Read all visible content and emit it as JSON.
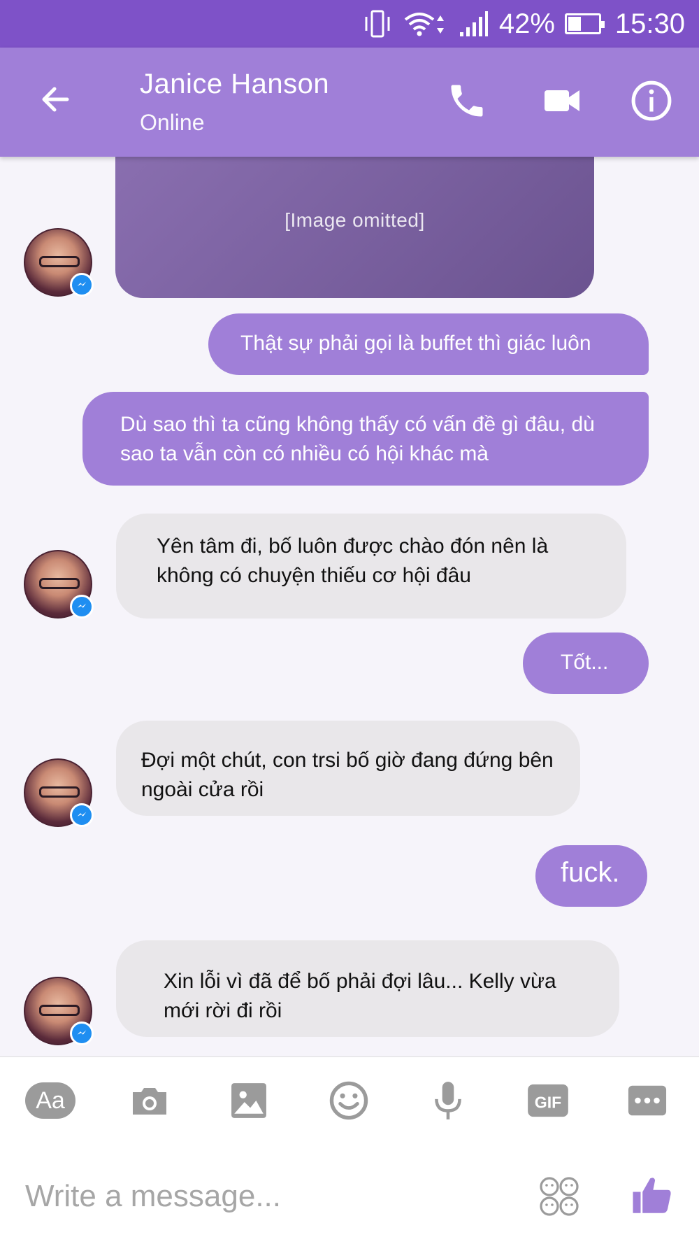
{
  "status_bar": {
    "battery_percent": "42%",
    "battery_level": 0.42,
    "time": "15:30",
    "icons": [
      "vibrate-icon",
      "wifi-icon",
      "signal-icon",
      "battery-icon"
    ]
  },
  "header": {
    "contact_name": "Janice Hanson",
    "contact_status": "Online",
    "icons": [
      "back-arrow-icon",
      "phone-icon",
      "video-camera-icon",
      "info-icon"
    ]
  },
  "thread": {
    "image_message": {
      "from": "contact",
      "placeholder_text": "[Image omitted]"
    },
    "messages": [
      {
        "from": "me",
        "text": "Thật sự phải gọi là buffet thì giác luôn"
      },
      {
        "from": "me",
        "text": "Dù sao thì ta cũng không thấy có vấn đề gì đâu, dù sao ta vẫn còn có nhiều có hội khác mà"
      },
      {
        "from": "contact",
        "text": "Yên tâm đi, bố luôn được chào đón nên là không có chuyện thiếu cơ hội đâu"
      },
      {
        "from": "me",
        "text": "Tốt..."
      },
      {
        "from": "contact",
        "text": "Đợi một chút, con trsi bố giờ đang đứng bên ngoài cửa rồi"
      },
      {
        "from": "me",
        "text": "fuck."
      },
      {
        "from": "contact",
        "text": "Xin lỗi vì đã để bố phải đợi lâu... Kelly vừa mới rời đi rồi"
      }
    ]
  },
  "composer": {
    "aa_label": "Aa",
    "placeholder": "Write a message...",
    "gif_label": "GIF",
    "icons": [
      "text-style-icon",
      "camera-icon",
      "gallery-icon",
      "emoji-icon",
      "microphone-icon",
      "gif-icon",
      "more-icon",
      "sticker-grid-icon",
      "thumbs-up-icon"
    ]
  },
  "colors": {
    "status_bar": "#7e52c8",
    "header": "#a07fd8",
    "outgoing_bubble": "#a07fd8",
    "incoming_bubble": "#e9e7ea",
    "icon_gray": "#9b9b9b",
    "messenger_badge": "#1f8ef1"
  }
}
